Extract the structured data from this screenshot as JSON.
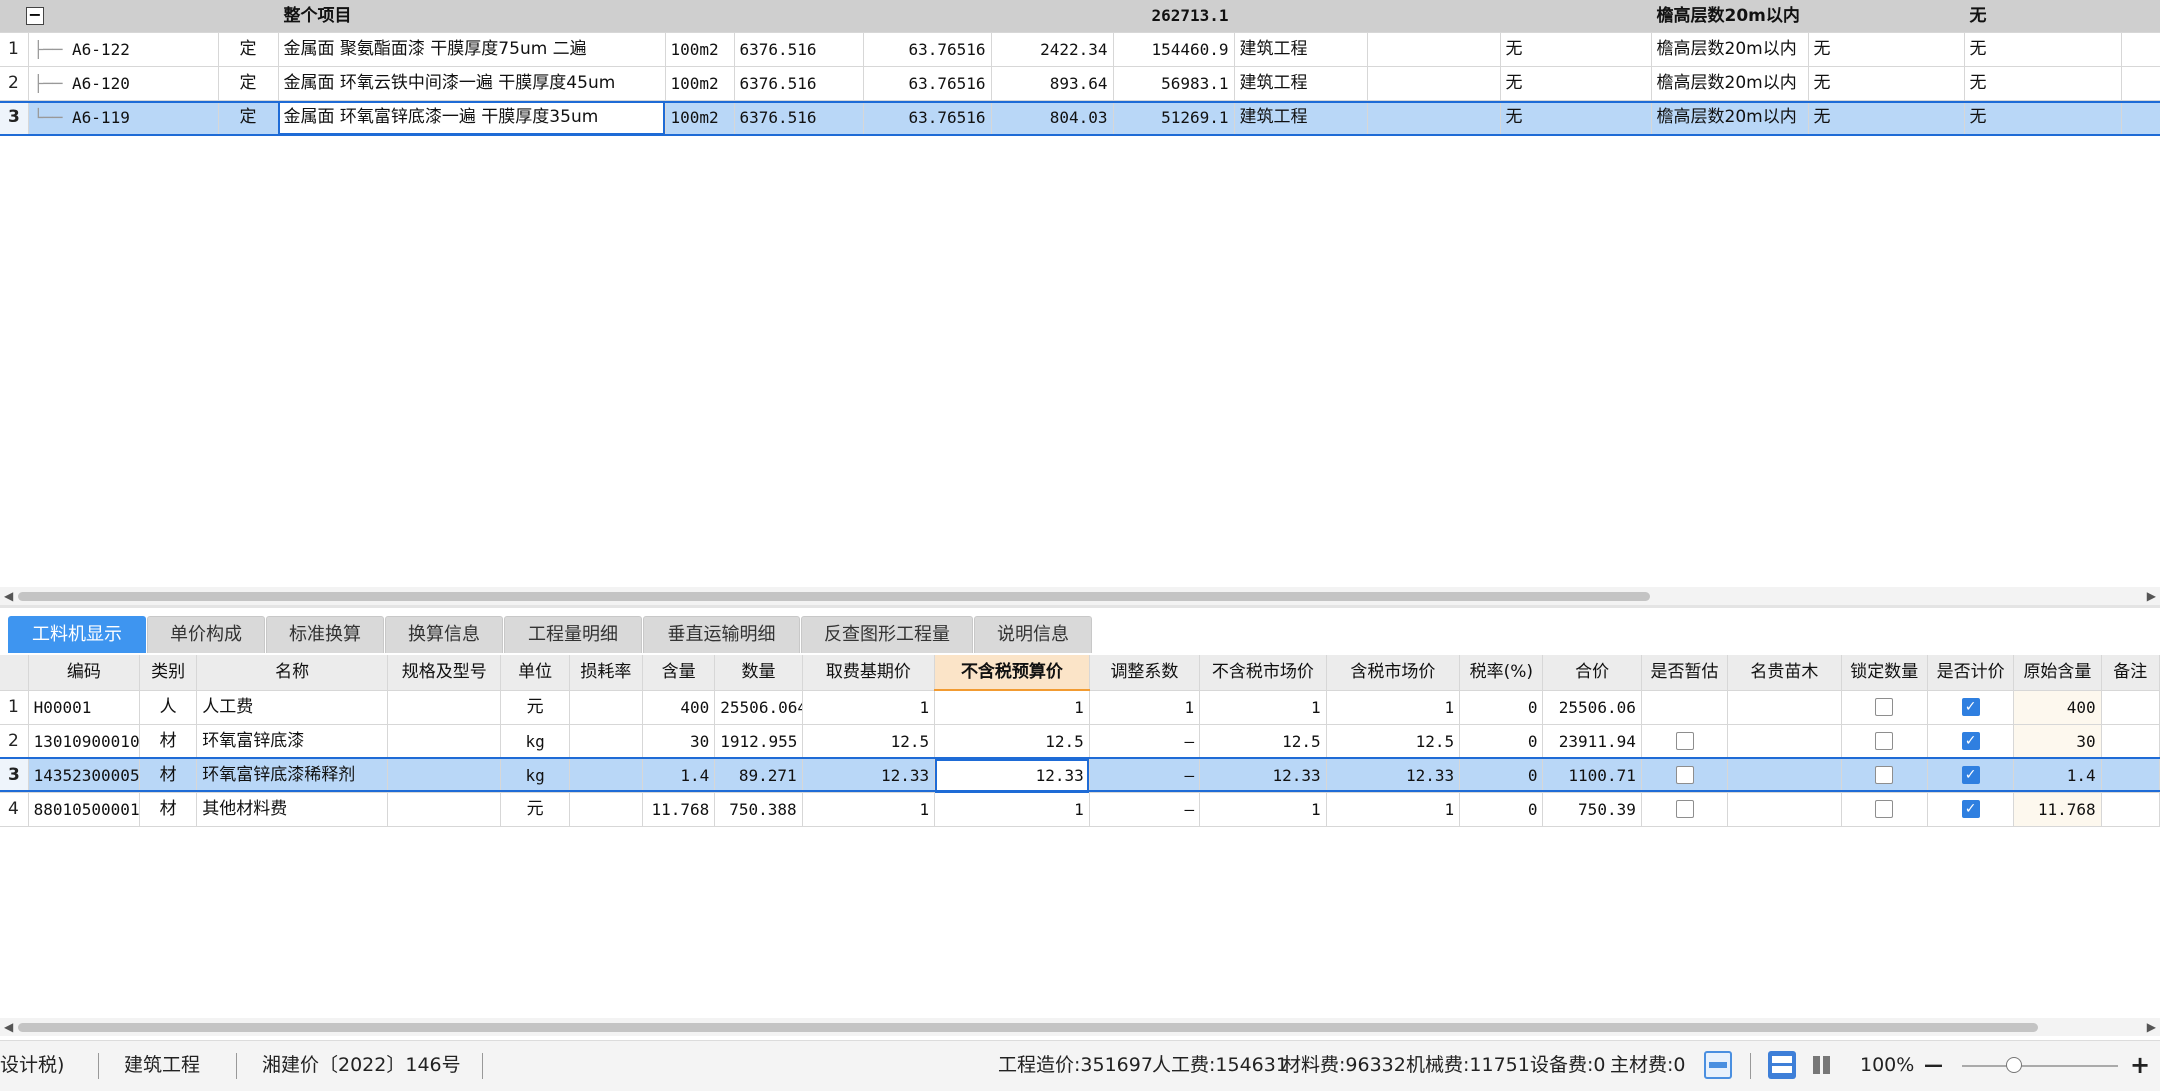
{
  "top_table": {
    "header_row": {
      "collapse_symbol": "−",
      "name": "整个项目",
      "total": "262713.1",
      "eave": "檐高层数20m以内",
      "last": "无"
    },
    "rows": [
      {
        "rn": "1",
        "code": "A6-122",
        "type": "定",
        "name": "金属面 聚氨酯面漆 干膜厚度75um 二遍",
        "unit": "100m2",
        "qty": "6376.516",
        "qty2": "63.76516",
        "price": "2422.34",
        "total": "154460.9",
        "major": "建筑工程",
        "c11": "",
        "c12": "无",
        "eave": "檐高层数20m以内",
        "c14": "无",
        "c15": "无"
      },
      {
        "rn": "2",
        "code": "A6-120",
        "type": "定",
        "name": "金属面 环氧云铁中间漆一遍 干膜厚度45um",
        "unit": "100m2",
        "qty": "6376.516",
        "qty2": "63.76516",
        "price": "893.64",
        "total": "56983.1",
        "major": "建筑工程",
        "c11": "",
        "c12": "无",
        "eave": "檐高层数20m以内",
        "c14": "无",
        "c15": "无"
      },
      {
        "rn": "3",
        "code": "A6-119",
        "type": "定",
        "name": "金属面 环氧富锌底漆一遍 干膜厚度35um",
        "unit": "100m2",
        "qty": "6376.516",
        "qty2": "63.76516",
        "price": "804.03",
        "total": "51269.1",
        "major": "建筑工程",
        "c11": "",
        "c12": "无",
        "eave": "檐高层数20m以内",
        "c14": "无",
        "c15": "无"
      }
    ]
  },
  "tabs": [
    {
      "label": "工料机显示"
    },
    {
      "label": "单价构成"
    },
    {
      "label": "标准换算"
    },
    {
      "label": "换算信息"
    },
    {
      "label": "工程量明细"
    },
    {
      "label": "垂直运输明细"
    },
    {
      "label": "反查图形工程量"
    },
    {
      "label": "说明信息"
    }
  ],
  "bottom_table": {
    "headers": [
      "编码",
      "类别",
      "名称",
      "规格及型号",
      "单位",
      "损耗率",
      "含量",
      "数量",
      "取费基期价",
      "不含税预算价",
      "调整系数",
      "不含税市场价",
      "含税市场价",
      "税率(%)",
      "合价",
      "是否暂估",
      "名贵苗木",
      "锁定数量",
      "是否计价",
      "原始含量",
      "备注"
    ],
    "rows": [
      {
        "rn": "1",
        "code": "H00001",
        "cat": "人",
        "name": "人工费",
        "spec": "",
        "unit": "元",
        "loss": "",
        "content": "400",
        "qty": "25506.064",
        "base": "1",
        "budget": "1",
        "coef": "1",
        "mkt": "1",
        "mkt_tax": "1",
        "rate": "0",
        "total": "25506.06",
        "estimate": false,
        "lock": false,
        "priced": true,
        "orig": "400"
      },
      {
        "rn": "2",
        "code": "13010900010",
        "cat": "材",
        "name": "环氧富锌底漆",
        "spec": "",
        "unit": "kg",
        "loss": "",
        "content": "30",
        "qty": "1912.955",
        "base": "12.5",
        "budget": "12.5",
        "coef": "—",
        "mkt": "12.5",
        "mkt_tax": "12.5",
        "rate": "0",
        "total": "23911.94",
        "estimate": false,
        "lock": false,
        "priced": true,
        "orig": "30"
      },
      {
        "rn": "3",
        "code": "14352300005",
        "cat": "材",
        "name": "环氧富锌底漆稀释剂",
        "spec": "",
        "unit": "kg",
        "loss": "",
        "content": "1.4",
        "qty": "89.271",
        "base": "12.33",
        "budget": "12.33",
        "coef": "—",
        "mkt": "12.33",
        "mkt_tax": "12.33",
        "rate": "0",
        "total": "1100.71",
        "estimate": false,
        "lock": false,
        "priced": true,
        "orig": "1.4"
      },
      {
        "rn": "4",
        "code": "88010500001",
        "cat": "材",
        "name": "其他材料费",
        "spec": "",
        "unit": "元",
        "loss": "",
        "content": "11.768",
        "qty": "750.388",
        "base": "1",
        "budget": "1",
        "coef": "—",
        "mkt": "1",
        "mkt_tax": "1",
        "rate": "0",
        "total": "750.39",
        "estimate": false,
        "lock": false,
        "priced": true,
        "orig": "11.768"
      }
    ]
  },
  "status": {
    "left1": "设计税)",
    "left2": "建筑工程",
    "left3": "湘建价〔2022〕146号",
    "cost": "工程造价:351697",
    "labor": "人工费:154631",
    "material": "材料费:96332",
    "machine": "机械费:11751",
    "equipment": "设备费:0",
    "main_material": "主材费:0",
    "zoom": "100%",
    "zoom_minus": "—",
    "zoom_plus": "+"
  },
  "colors": {
    "accent": "#3e95f0",
    "selection": "#b9d7f7",
    "header_highlight": "#fbe4c8"
  }
}
